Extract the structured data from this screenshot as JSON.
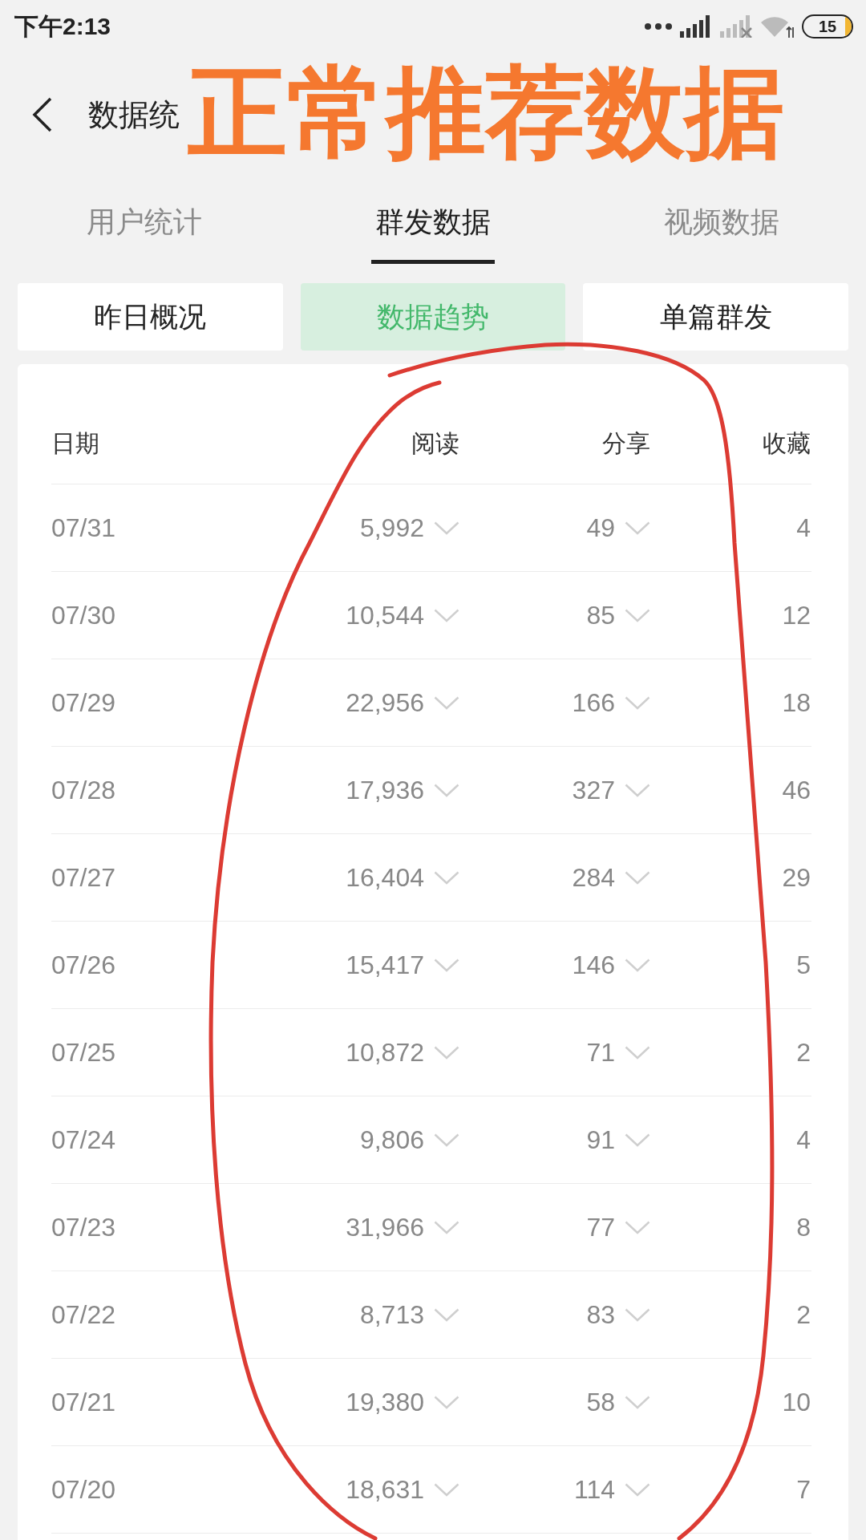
{
  "status_bar": {
    "time": "下午2:13",
    "battery": "15"
  },
  "header": {
    "title": "数据统"
  },
  "annotation": {
    "text": "正常推荐数据"
  },
  "tabs": [
    {
      "label": "用户统计",
      "selected": false
    },
    {
      "label": "群发数据",
      "selected": true
    },
    {
      "label": "视频数据",
      "selected": false
    }
  ],
  "segments": [
    {
      "label": "昨日概况",
      "selected": false
    },
    {
      "label": "数据趋势",
      "selected": true
    },
    {
      "label": "单篇群发",
      "selected": false
    }
  ],
  "table": {
    "columns": [
      "日期",
      "阅读",
      "分享",
      "收藏"
    ],
    "rows": [
      {
        "date": "07/31",
        "reads": "5,992",
        "shares": "49",
        "favorites": "4"
      },
      {
        "date": "07/30",
        "reads": "10,544",
        "shares": "85",
        "favorites": "12"
      },
      {
        "date": "07/29",
        "reads": "22,956",
        "shares": "166",
        "favorites": "18"
      },
      {
        "date": "07/28",
        "reads": "17,936",
        "shares": "327",
        "favorites": "46"
      },
      {
        "date": "07/27",
        "reads": "16,404",
        "shares": "284",
        "favorites": "29"
      },
      {
        "date": "07/26",
        "reads": "15,417",
        "shares": "146",
        "favorites": "5"
      },
      {
        "date": "07/25",
        "reads": "10,872",
        "shares": "71",
        "favorites": "2"
      },
      {
        "date": "07/24",
        "reads": "9,806",
        "shares": "91",
        "favorites": "4"
      },
      {
        "date": "07/23",
        "reads": "31,966",
        "shares": "77",
        "favorites": "8"
      },
      {
        "date": "07/22",
        "reads": "8,713",
        "shares": "83",
        "favorites": "2"
      },
      {
        "date": "07/21",
        "reads": "19,380",
        "shares": "58",
        "favorites": "10"
      },
      {
        "date": "07/20",
        "reads": "18,631",
        "shares": "114",
        "favorites": "7"
      }
    ]
  }
}
